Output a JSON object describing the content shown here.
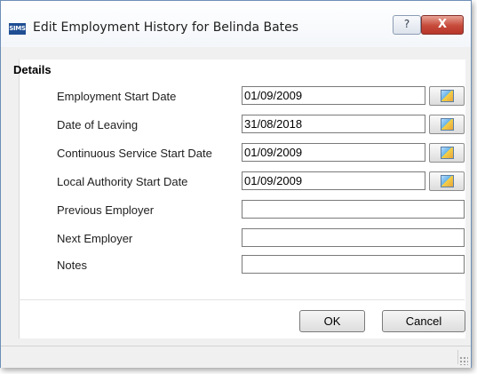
{
  "window": {
    "title": "Edit Employment History for Belinda Bates",
    "app_icon_label": "SIMS",
    "help_label": "?",
    "close_label": "X"
  },
  "details": {
    "section_title": "Details",
    "fields": [
      {
        "label": "Employment Start Date",
        "value": "01/09/2009"
      },
      {
        "label": "Date of Leaving",
        "value": "31/08/2018"
      },
      {
        "label": "Continuous Service Start Date",
        "value": "01/09/2009"
      },
      {
        "label": "Local Authority Start Date",
        "value": "01/09/2009"
      },
      {
        "label": "Previous Employer",
        "value": ""
      },
      {
        "label": "Next Employer",
        "value": ""
      },
      {
        "label": "Notes",
        "value": ""
      }
    ]
  },
  "buttons": {
    "ok_label": "OK",
    "cancel_label": "Cancel"
  },
  "icons": {
    "calendar": "calendar-icon",
    "help": "help-icon",
    "close": "close-icon",
    "resize": "resize-grip-icon"
  },
  "colors": {
    "close_button": "#c64a3a",
    "app_icon": "#1f4e93",
    "window_border": "#6d8fb6"
  }
}
